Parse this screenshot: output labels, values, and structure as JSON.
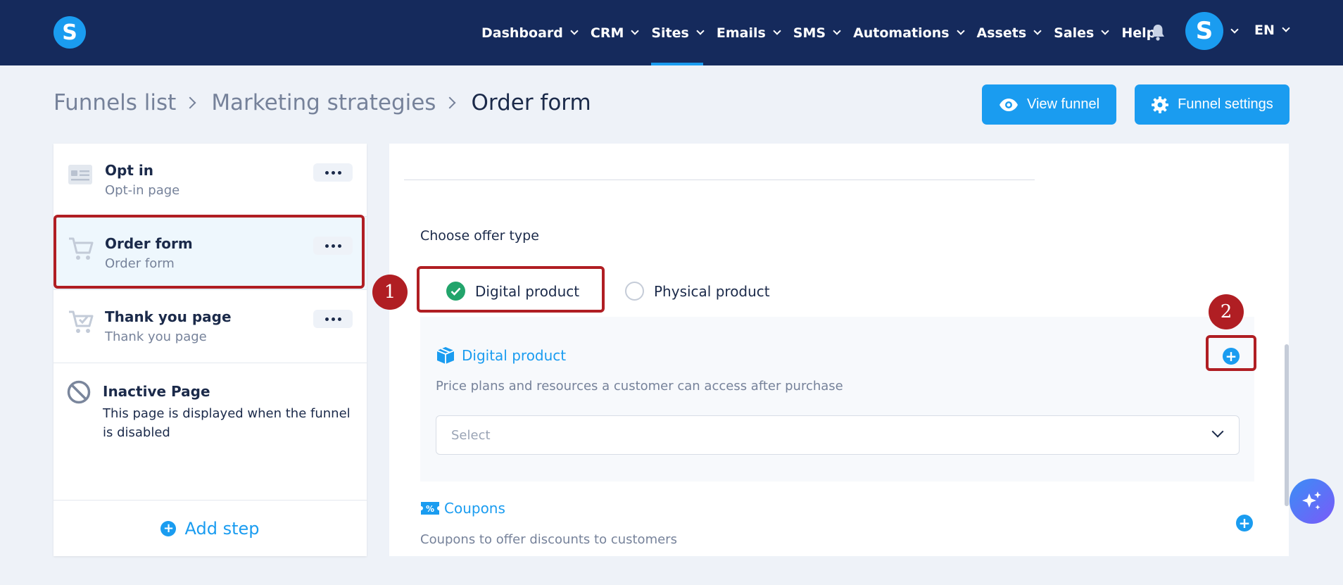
{
  "app": {
    "logo_letter": "S"
  },
  "nav": {
    "items": [
      {
        "label": "Dashboard",
        "has_menu": true
      },
      {
        "label": "CRM",
        "has_menu": true
      },
      {
        "label": "Sites",
        "has_menu": true,
        "active": true
      },
      {
        "label": "Emails",
        "has_menu": true
      },
      {
        "label": "SMS",
        "has_menu": true
      },
      {
        "label": "Automations",
        "has_menu": true
      },
      {
        "label": "Assets",
        "has_menu": true
      },
      {
        "label": "Sales",
        "has_menu": true
      },
      {
        "label": "Help",
        "has_menu": false
      }
    ],
    "avatar_letter": "S",
    "language": "EN"
  },
  "breadcrumb": {
    "items": [
      "Funnels list",
      "Marketing strategies"
    ],
    "current": "Order form"
  },
  "actions": {
    "view_funnel": "View funnel",
    "funnel_settings": "Funnel settings"
  },
  "steps": [
    {
      "title": "Opt in",
      "subtitle": "Opt-in page",
      "icon": "opt-in-page-icon"
    },
    {
      "title": "Order form",
      "subtitle": "Order form",
      "icon": "cart-icon",
      "selected": true
    },
    {
      "title": "Thank you page",
      "subtitle": "Thank you page",
      "icon": "cart-check-icon"
    }
  ],
  "inactive_page": {
    "title": "Inactive Page",
    "description": "This page is displayed when the funnel is disabled"
  },
  "add_step": "Add step",
  "offer": {
    "label": "Choose offer type",
    "options": [
      {
        "label": "Digital product",
        "selected": true
      },
      {
        "label": "Physical product",
        "selected": false
      }
    ]
  },
  "digital_product": {
    "title": "Digital product",
    "description": "Price plans and resources a customer can access after purchase",
    "select_placeholder": "Select"
  },
  "coupons": {
    "title": "Coupons",
    "description": "Coupons to offer discounts to customers"
  },
  "annotations": {
    "badge_1": "1",
    "badge_2": "2"
  },
  "colors": {
    "nav_bg": "#152a5c",
    "accent": "#1a9cf0",
    "highlight": "#b01e23",
    "success": "#22a46b"
  }
}
